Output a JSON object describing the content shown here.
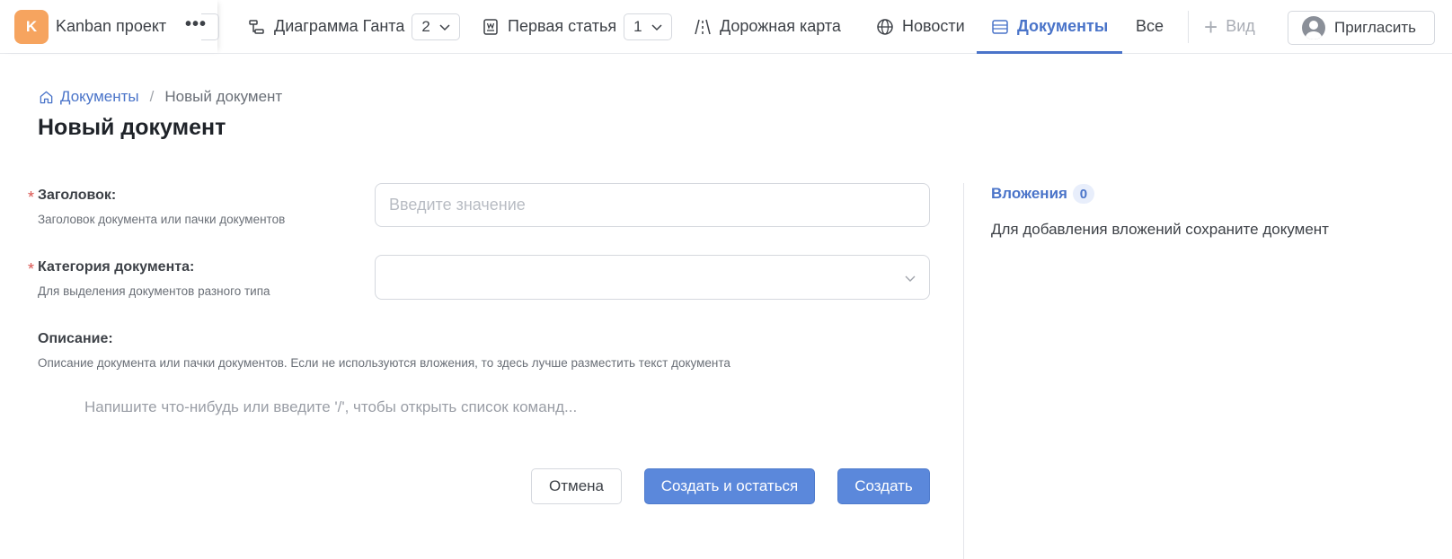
{
  "project": {
    "logo_letter": "K",
    "name": "Kanban проект",
    "more": "•••"
  },
  "tabs": [
    {
      "label": "Диаграмма Ганта",
      "icon": "gantt-icon",
      "count": "2"
    },
    {
      "label": "Первая статья",
      "icon": "article-icon",
      "count": "1"
    },
    {
      "label": "Дорожная карта",
      "icon": "roadmap-icon"
    },
    {
      "label": "Новости",
      "icon": "globe-icon"
    },
    {
      "label": "Документы",
      "icon": "documents-icon",
      "active": true
    },
    {
      "label": "Все"
    }
  ],
  "view_button": {
    "plus": "+",
    "label": "Вид"
  },
  "invite_button": {
    "label": "Пригласить"
  },
  "breadcrumb": {
    "home": "Документы",
    "separator": "/",
    "current": "Новый документ"
  },
  "page_title": "Новый документ",
  "form": {
    "title_field": {
      "required_mark": "*",
      "label": "Заголовок:",
      "hint": "Заголовок документа или пачки документов",
      "value": "",
      "placeholder": "Введите значение"
    },
    "category_field": {
      "required_mark": "*",
      "label": "Категория документа:",
      "hint": "Для выделения документов разного типа",
      "value": ""
    },
    "description_field": {
      "label": "Описание:",
      "hint": "Описание документа или пачки документов. Если не используются вложения, то здесь лучше разместить текст документа",
      "placeholder": "Напишите что-нибудь или введите '/', чтобы открыть список команд..."
    }
  },
  "buttons": {
    "cancel": "Отмена",
    "create_stay": "Создать и остаться",
    "create": "Создать"
  },
  "attachments": {
    "title": "Вложения",
    "count": "0",
    "message": "Для добавления вложений сохраните документ"
  },
  "colors": {
    "accent": "#4a74c9",
    "primary_button": "#5b88db",
    "logo": "#f6a45f",
    "required": "#d9534f"
  }
}
